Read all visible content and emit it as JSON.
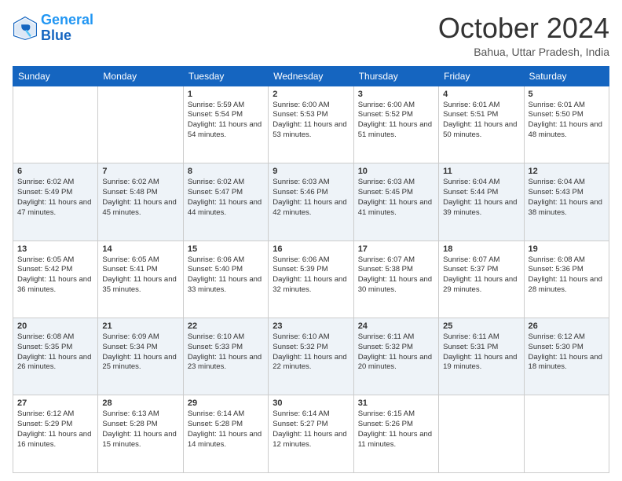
{
  "header": {
    "logo_line1": "General",
    "logo_line2": "Blue",
    "month": "October 2024",
    "location": "Bahua, Uttar Pradesh, India"
  },
  "days_of_week": [
    "Sunday",
    "Monday",
    "Tuesday",
    "Wednesday",
    "Thursday",
    "Friday",
    "Saturday"
  ],
  "weeks": [
    [
      {
        "day": "",
        "sunrise": "",
        "sunset": "",
        "daylight": ""
      },
      {
        "day": "",
        "sunrise": "",
        "sunset": "",
        "daylight": ""
      },
      {
        "day": "1",
        "sunrise": "Sunrise: 5:59 AM",
        "sunset": "Sunset: 5:54 PM",
        "daylight": "Daylight: 11 hours and 54 minutes."
      },
      {
        "day": "2",
        "sunrise": "Sunrise: 6:00 AM",
        "sunset": "Sunset: 5:53 PM",
        "daylight": "Daylight: 11 hours and 53 minutes."
      },
      {
        "day": "3",
        "sunrise": "Sunrise: 6:00 AM",
        "sunset": "Sunset: 5:52 PM",
        "daylight": "Daylight: 11 hours and 51 minutes."
      },
      {
        "day": "4",
        "sunrise": "Sunrise: 6:01 AM",
        "sunset": "Sunset: 5:51 PM",
        "daylight": "Daylight: 11 hours and 50 minutes."
      },
      {
        "day": "5",
        "sunrise": "Sunrise: 6:01 AM",
        "sunset": "Sunset: 5:50 PM",
        "daylight": "Daylight: 11 hours and 48 minutes."
      }
    ],
    [
      {
        "day": "6",
        "sunrise": "Sunrise: 6:02 AM",
        "sunset": "Sunset: 5:49 PM",
        "daylight": "Daylight: 11 hours and 47 minutes."
      },
      {
        "day": "7",
        "sunrise": "Sunrise: 6:02 AM",
        "sunset": "Sunset: 5:48 PM",
        "daylight": "Daylight: 11 hours and 45 minutes."
      },
      {
        "day": "8",
        "sunrise": "Sunrise: 6:02 AM",
        "sunset": "Sunset: 5:47 PM",
        "daylight": "Daylight: 11 hours and 44 minutes."
      },
      {
        "day": "9",
        "sunrise": "Sunrise: 6:03 AM",
        "sunset": "Sunset: 5:46 PM",
        "daylight": "Daylight: 11 hours and 42 minutes."
      },
      {
        "day": "10",
        "sunrise": "Sunrise: 6:03 AM",
        "sunset": "Sunset: 5:45 PM",
        "daylight": "Daylight: 11 hours and 41 minutes."
      },
      {
        "day": "11",
        "sunrise": "Sunrise: 6:04 AM",
        "sunset": "Sunset: 5:44 PM",
        "daylight": "Daylight: 11 hours and 39 minutes."
      },
      {
        "day": "12",
        "sunrise": "Sunrise: 6:04 AM",
        "sunset": "Sunset: 5:43 PM",
        "daylight": "Daylight: 11 hours and 38 minutes."
      }
    ],
    [
      {
        "day": "13",
        "sunrise": "Sunrise: 6:05 AM",
        "sunset": "Sunset: 5:42 PM",
        "daylight": "Daylight: 11 hours and 36 minutes."
      },
      {
        "day": "14",
        "sunrise": "Sunrise: 6:05 AM",
        "sunset": "Sunset: 5:41 PM",
        "daylight": "Daylight: 11 hours and 35 minutes."
      },
      {
        "day": "15",
        "sunrise": "Sunrise: 6:06 AM",
        "sunset": "Sunset: 5:40 PM",
        "daylight": "Daylight: 11 hours and 33 minutes."
      },
      {
        "day": "16",
        "sunrise": "Sunrise: 6:06 AM",
        "sunset": "Sunset: 5:39 PM",
        "daylight": "Daylight: 11 hours and 32 minutes."
      },
      {
        "day": "17",
        "sunrise": "Sunrise: 6:07 AM",
        "sunset": "Sunset: 5:38 PM",
        "daylight": "Daylight: 11 hours and 30 minutes."
      },
      {
        "day": "18",
        "sunrise": "Sunrise: 6:07 AM",
        "sunset": "Sunset: 5:37 PM",
        "daylight": "Daylight: 11 hours and 29 minutes."
      },
      {
        "day": "19",
        "sunrise": "Sunrise: 6:08 AM",
        "sunset": "Sunset: 5:36 PM",
        "daylight": "Daylight: 11 hours and 28 minutes."
      }
    ],
    [
      {
        "day": "20",
        "sunrise": "Sunrise: 6:08 AM",
        "sunset": "Sunset: 5:35 PM",
        "daylight": "Daylight: 11 hours and 26 minutes."
      },
      {
        "day": "21",
        "sunrise": "Sunrise: 6:09 AM",
        "sunset": "Sunset: 5:34 PM",
        "daylight": "Daylight: 11 hours and 25 minutes."
      },
      {
        "day": "22",
        "sunrise": "Sunrise: 6:10 AM",
        "sunset": "Sunset: 5:33 PM",
        "daylight": "Daylight: 11 hours and 23 minutes."
      },
      {
        "day": "23",
        "sunrise": "Sunrise: 6:10 AM",
        "sunset": "Sunset: 5:32 PM",
        "daylight": "Daylight: 11 hours and 22 minutes."
      },
      {
        "day": "24",
        "sunrise": "Sunrise: 6:11 AM",
        "sunset": "Sunset: 5:32 PM",
        "daylight": "Daylight: 11 hours and 20 minutes."
      },
      {
        "day": "25",
        "sunrise": "Sunrise: 6:11 AM",
        "sunset": "Sunset: 5:31 PM",
        "daylight": "Daylight: 11 hours and 19 minutes."
      },
      {
        "day": "26",
        "sunrise": "Sunrise: 6:12 AM",
        "sunset": "Sunset: 5:30 PM",
        "daylight": "Daylight: 11 hours and 18 minutes."
      }
    ],
    [
      {
        "day": "27",
        "sunrise": "Sunrise: 6:12 AM",
        "sunset": "Sunset: 5:29 PM",
        "daylight": "Daylight: 11 hours and 16 minutes."
      },
      {
        "day": "28",
        "sunrise": "Sunrise: 6:13 AM",
        "sunset": "Sunset: 5:28 PM",
        "daylight": "Daylight: 11 hours and 15 minutes."
      },
      {
        "day": "29",
        "sunrise": "Sunrise: 6:14 AM",
        "sunset": "Sunset: 5:28 PM",
        "daylight": "Daylight: 11 hours and 14 minutes."
      },
      {
        "day": "30",
        "sunrise": "Sunrise: 6:14 AM",
        "sunset": "Sunset: 5:27 PM",
        "daylight": "Daylight: 11 hours and 12 minutes."
      },
      {
        "day": "31",
        "sunrise": "Sunrise: 6:15 AM",
        "sunset": "Sunset: 5:26 PM",
        "daylight": "Daylight: 11 hours and 11 minutes."
      },
      {
        "day": "",
        "sunrise": "",
        "sunset": "",
        "daylight": ""
      },
      {
        "day": "",
        "sunrise": "",
        "sunset": "",
        "daylight": ""
      }
    ]
  ]
}
